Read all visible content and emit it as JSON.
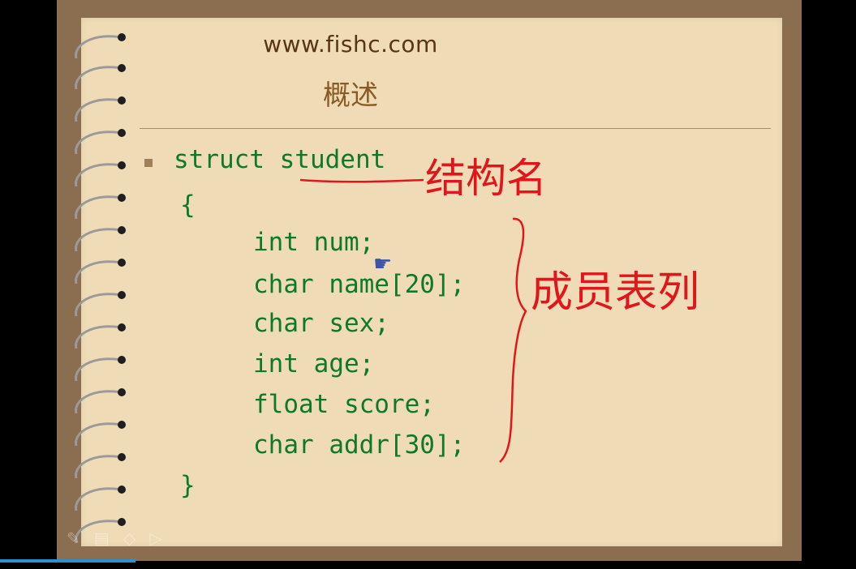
{
  "slide": {
    "url": "www.fishc.com",
    "title": "概述"
  },
  "code": {
    "line1": "struct student",
    "line2": "{",
    "line3": "int num;",
    "line4": "char name[20];",
    "line5": "char sex;",
    "line6": "int age;",
    "line7": "float score;",
    "line8": "char addr[30];",
    "line9": "}"
  },
  "annotations": {
    "struct_label": "结构名",
    "members_label": "成员表列",
    "ink_color": "#e0161c"
  },
  "toolbar": {
    "icons": [
      "pen-icon",
      "eraser-icon",
      "highlighter-icon",
      "pointer-icon"
    ]
  },
  "colors": {
    "code_text": "#0e7a27",
    "paper": "#efdcb6",
    "frame": "#8b6e4f"
  }
}
